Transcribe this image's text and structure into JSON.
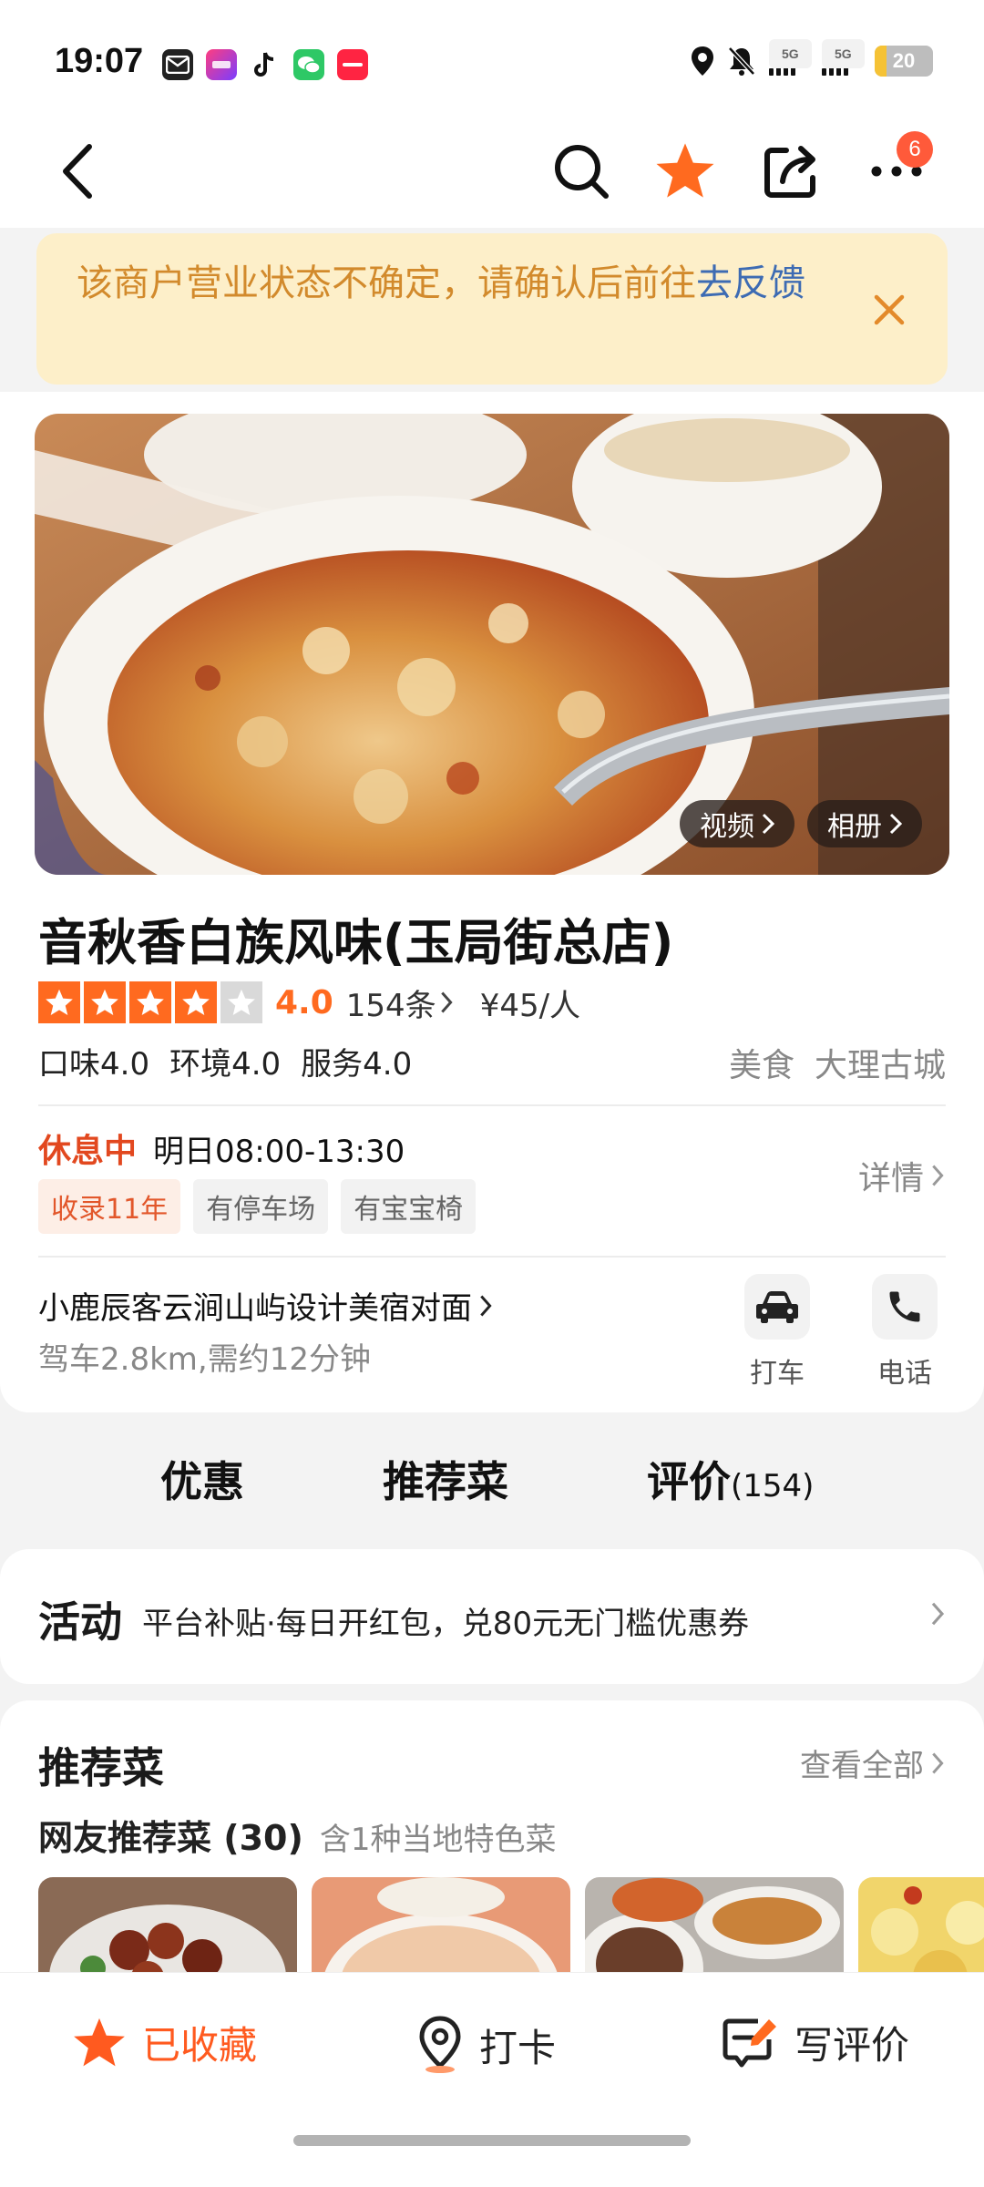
{
  "status_bar": {
    "time": "19:07",
    "network_1": "5G",
    "network_2": "5G",
    "battery": "20",
    "battery_level": 0.2,
    "app_icons": [
      "mail-icon",
      "bank-app-icon",
      "tiktok-icon",
      "wechat-icon",
      "xiaohongshu-icon"
    ]
  },
  "nav": {
    "more_badge": "6",
    "favorited": true,
    "accent": "#ff6a1f"
  },
  "notice": {
    "text": "该商户营业状态不确定，请确认后前往",
    "link": "去反馈"
  },
  "gallery": {
    "video_label": "视频",
    "album_label": "相册"
  },
  "shop": {
    "name": "音秋香白族风味(玉局街总店)",
    "stars": 4,
    "star_total": 5,
    "score": "4.0",
    "review_count": "154条",
    "price": "¥45/人",
    "sub_scores": [
      "口味4.0",
      "环境4.0",
      "服务4.0"
    ],
    "category": "美食",
    "area": "大理古城",
    "status": "休息中",
    "hours": "明日08:00-13:30",
    "tags": [
      "收录11年",
      "有停车场",
      "有宝宝椅"
    ],
    "details_label": "详情",
    "address": "小鹿辰客云涧山屿设计美宿对面",
    "drive_info": "驾车2.8km,需约12分钟",
    "taxi_label": "打车",
    "phone_label": "电话"
  },
  "tabs": [
    {
      "label": "优惠",
      "count": ""
    },
    {
      "label": "推荐菜",
      "count": ""
    },
    {
      "label": "评价",
      "count": "(154)"
    }
  ],
  "activity": {
    "title": "活动",
    "text": "平台补贴·每日开红包，兑80元无门槛优惠券"
  },
  "recommend": {
    "title": "推荐菜",
    "view_all": "查看全部",
    "subtitle": "网友推荐菜 (30)",
    "note": "含1种当地特色菜"
  },
  "bottom": {
    "favorite_label": "已收藏",
    "checkin_label": "打卡",
    "review_label": "写评价"
  }
}
